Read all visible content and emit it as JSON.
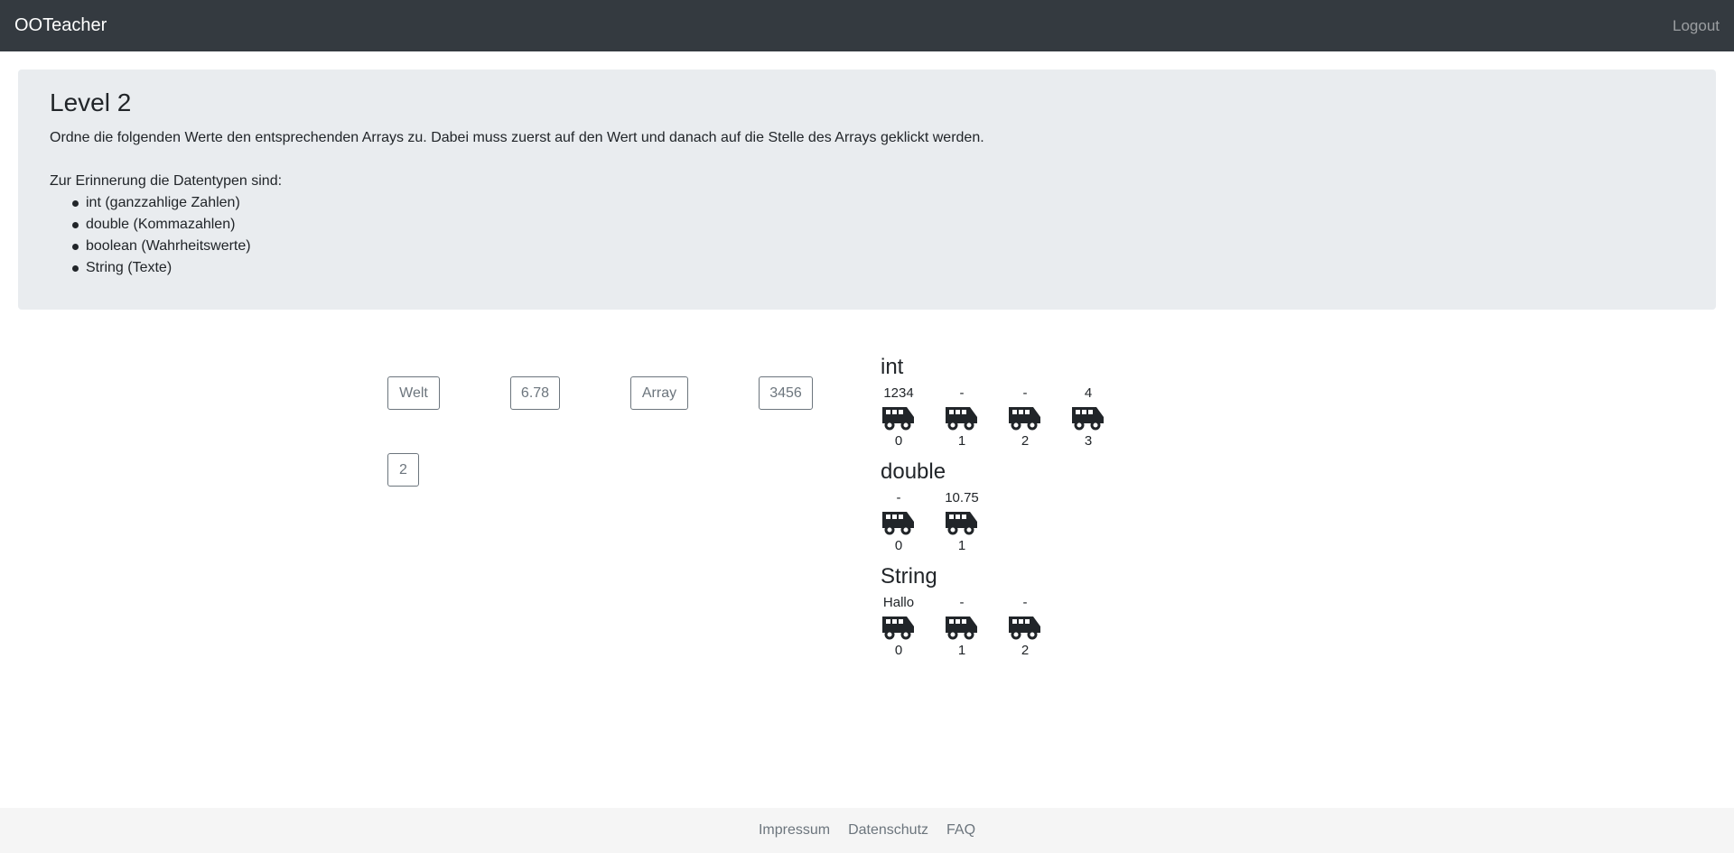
{
  "navbar": {
    "brand": "OOTeacher",
    "logout": "Logout"
  },
  "intro": {
    "title": "Level 2",
    "instruction": "Ordne die folgenden Werte den entsprechenden Arrays zu. Dabei muss zuerst auf den Wert und danach auf die Stelle des Arrays geklickt werden.",
    "reminder": "Zur Erinnerung die Datentypen sind:",
    "types": [
      "int (ganzzahlige Zahlen)",
      "double (Kommazahlen)",
      "boolean (Wahrheitswerte)",
      "String (Texte)"
    ]
  },
  "values": [
    "Welt",
    "6.78",
    "Array",
    "3456",
    "2"
  ],
  "arrays": [
    {
      "name": "int",
      "slots": [
        {
          "value": "1234",
          "index": "0"
        },
        {
          "value": "-",
          "index": "1"
        },
        {
          "value": "-",
          "index": "2"
        },
        {
          "value": "4",
          "index": "3"
        }
      ]
    },
    {
      "name": "double",
      "slots": [
        {
          "value": "-",
          "index": "0"
        },
        {
          "value": "10.75",
          "index": "1"
        }
      ]
    },
    {
      "name": "String",
      "slots": [
        {
          "value": "Hallo",
          "index": "0"
        },
        {
          "value": "-",
          "index": "1"
        },
        {
          "value": "-",
          "index": "2"
        }
      ]
    }
  ],
  "footer": {
    "links": [
      "Impressum",
      "Datenschutz",
      "FAQ"
    ]
  },
  "icons": {
    "slot": "bus-icon"
  },
  "colors": {
    "navbar": "#343a40",
    "jumbotron": "#e9ecef",
    "footer": "#f5f5f5",
    "secondary": "#6c757d"
  }
}
